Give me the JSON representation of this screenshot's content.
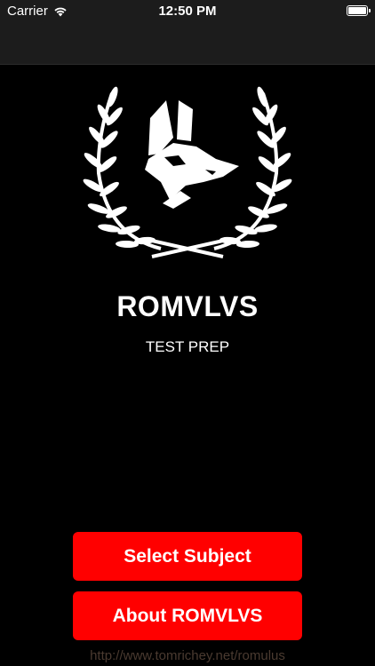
{
  "status_bar": {
    "carrier": "Carrier",
    "time": "12:50 PM",
    "wifi_icon": "wifi-icon",
    "battery_icon": "battery-icon",
    "battery_level": 1.0
  },
  "main": {
    "logo_icon": "wolf-laurel-logo",
    "title": "ROMVLVS",
    "subtitle": "TEST PREP"
  },
  "buttons": {
    "select_subject": "Select Subject",
    "about": "About ROMVLVS"
  },
  "footer": {
    "link_text": "http://www.tomrichey.net/romulus"
  },
  "colors": {
    "background": "#000000",
    "button": "#ff0000",
    "text": "#ffffff",
    "link": "#4a3a30"
  }
}
